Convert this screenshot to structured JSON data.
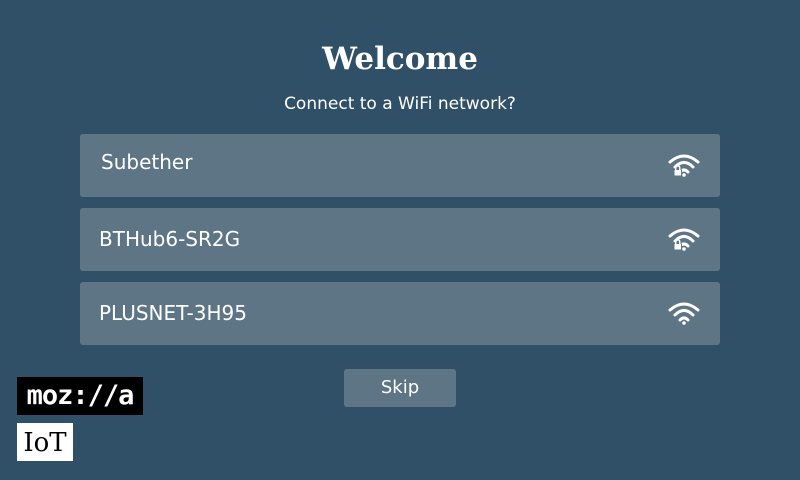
{
  "header": {
    "title": "Welcome",
    "subtitle": "Connect to a WiFi network?"
  },
  "networks": [
    {
      "name": "Subether",
      "icon": "wifi-locked-icon",
      "secured": true
    },
    {
      "name": "BTHub6-SR2G",
      "icon": "wifi-locked-icon",
      "secured": true
    },
    {
      "name": "PLUSNET-3H95",
      "icon": "wifi-icon",
      "secured": false
    }
  ],
  "actions": {
    "skip_label": "Skip"
  },
  "branding": {
    "mozilla_logo": "moz://a",
    "iot_logo": "IoT"
  },
  "colors": {
    "background": "#305067",
    "item_background": "#5e7586",
    "text": "#ffffff"
  }
}
